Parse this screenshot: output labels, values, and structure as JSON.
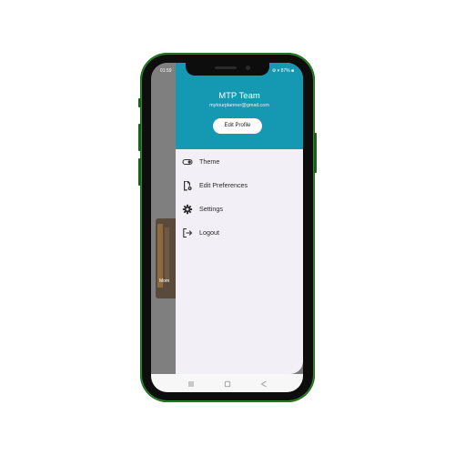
{
  "status_bar": {
    "time": "01:59",
    "indicators": "⚙ ▾ 87% ■"
  },
  "background": {
    "card_text": "Mom"
  },
  "drawer": {
    "header": {
      "user_name": "MTP Team",
      "user_email": "mytourplanner@gmail.com",
      "edit_profile_label": "Edit Profile",
      "color": "#1598b1"
    },
    "menu": [
      {
        "label": "Theme",
        "icon": "toggle-icon"
      },
      {
        "label": "Edit Preferences",
        "icon": "edit-preferences-icon"
      },
      {
        "label": "Settings",
        "icon": "gear-icon"
      },
      {
        "label": "Logout",
        "icon": "logout-icon"
      }
    ]
  },
  "nav_bar": {
    "icons": [
      "recents-icon",
      "home-icon",
      "back-icon"
    ]
  }
}
